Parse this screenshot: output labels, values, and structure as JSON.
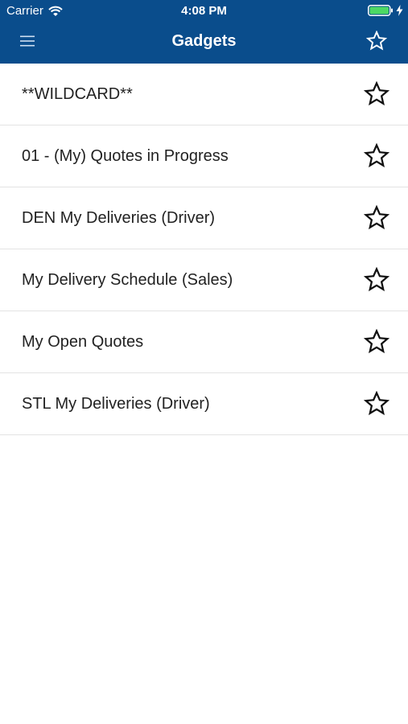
{
  "status_bar": {
    "carrier": "Carrier",
    "time": "4:08 PM",
    "wifi_icon": "wifi-icon",
    "battery_icon": "battery-icon",
    "charging_icon": "charging-bolt-icon"
  },
  "nav": {
    "title": "Gadgets",
    "menu_icon": "hamburger-menu-icon",
    "favorites_icon": "star-outline-icon"
  },
  "gadgets": [
    {
      "label": "**WILDCARD**",
      "favorite": false
    },
    {
      "label": "01 - (My) Quotes in Progress",
      "favorite": false
    },
    {
      "label": "DEN My Deliveries (Driver)",
      "favorite": false
    },
    {
      "label": "My Delivery Schedule (Sales)",
      "favorite": false
    },
    {
      "label": "My Open Quotes",
      "favorite": false
    },
    {
      "label": "STL My Deliveries (Driver)",
      "favorite": false
    }
  ],
  "colors": {
    "header_bg": "#0a4d8c",
    "battery_fill": "#4cd964",
    "text": "#222222",
    "divider": "#e3e3e3"
  }
}
